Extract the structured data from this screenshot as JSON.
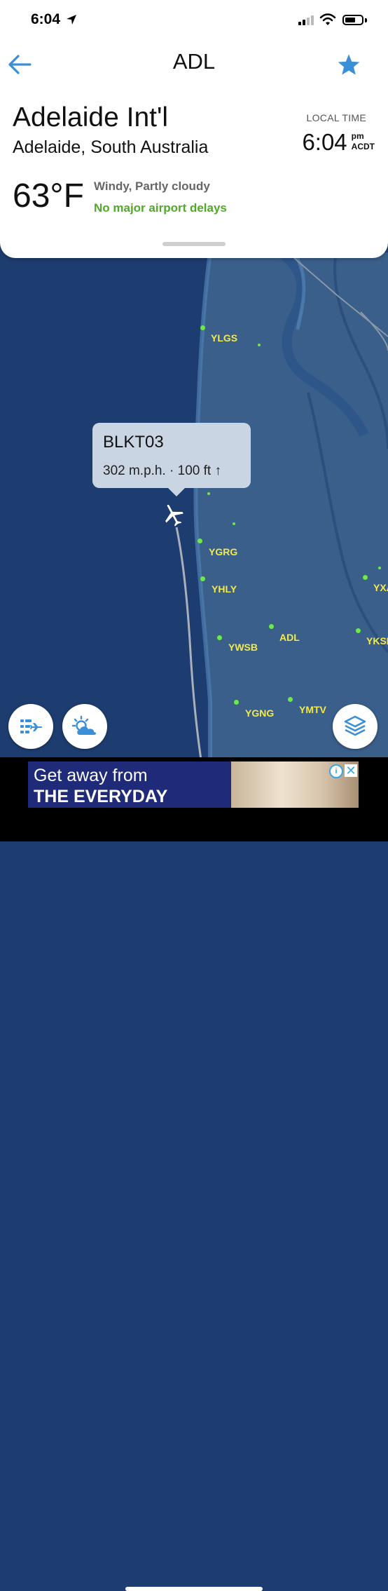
{
  "status_bar": {
    "time": "6:04"
  },
  "header": {
    "title": "ADL"
  },
  "airport": {
    "name": "Adelaide Int'l",
    "city": "Adelaide, South Australia",
    "local_time_label": "LOCAL TIME",
    "local_time": "6:04",
    "ampm": "pm",
    "timezone": "ACDT",
    "temperature": "63°F",
    "weather": "Windy, Partly cloudy",
    "delay_status": "No major airport delays"
  },
  "colors": {
    "accent": "#3a8fd6",
    "delay_ok": "#52a829",
    "ocean": "#1d3d70",
    "land": "#3a5f8a",
    "label": "#f2ea4c"
  },
  "map": {
    "airports": [
      "YLGS",
      "YGRG",
      "YHLY",
      "ADL",
      "YWSB",
      "YKSI",
      "YXA",
      "YGNG",
      "YMTV"
    ],
    "flight": {
      "callsign": "BLKT03",
      "details": "302 m.p.h. · 100 ft ↑"
    }
  },
  "controls": {
    "flights_icon": "flights-list-icon",
    "weather_icon": "weather-icon",
    "layers_icon": "layers-icon"
  },
  "ad": {
    "line1": "Get away from",
    "line2": "THE EVERYDAY",
    "info": "i",
    "close": "✕"
  }
}
